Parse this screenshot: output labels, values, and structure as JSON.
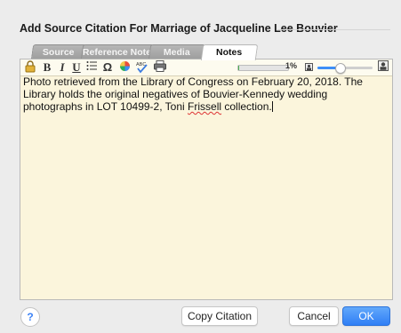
{
  "dialog": {
    "title": "Add Source Citation For Marriage of Jacqueline Lee Bouvier"
  },
  "tabs": [
    {
      "label": "Source",
      "active": false
    },
    {
      "label": "Reference Note",
      "active": false
    },
    {
      "label": "Media",
      "active": false
    },
    {
      "label": "Notes",
      "active": true
    }
  ],
  "toolbar": {
    "items": [
      "lock-icon",
      "bold",
      "italic",
      "underline",
      "list-icon",
      "omega-icon",
      "color-icon",
      "spellcheck-icon",
      "print-icon"
    ],
    "bold_label": "B",
    "italic_label": "I",
    "underline_label": "U",
    "omega_label": "Ω",
    "zoom_percent": 0.01,
    "zoom_text": "1%",
    "slider_value": 0.4,
    "accent_color": "#3d8ef7"
  },
  "notes": {
    "text_before": "Photo retrieved from the Library of Congress on February 20, 2018. The Library holds the original negatives of Bouvier-Kennedy wedding photographs in LOT 10499-2, Toni ",
    "misspelled_word": "Frissell",
    "text_after": " collection."
  },
  "footer": {
    "help_label": "?",
    "copy_citation_label": "Copy Citation",
    "cancel_label": "Cancel",
    "ok_label": "OK"
  }
}
